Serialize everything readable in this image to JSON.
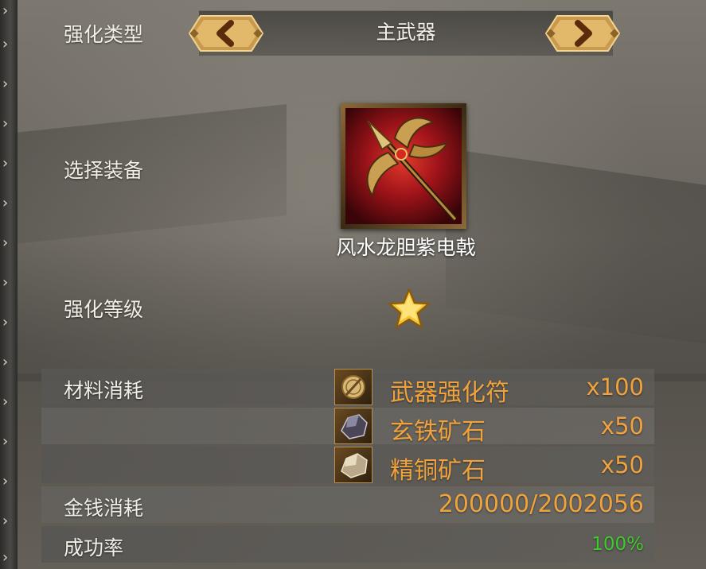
{
  "enhance_type": {
    "label": "强化类型",
    "value": "主武器"
  },
  "select_equipment": {
    "label": "选择装备",
    "item_name": "风水龙胆紫电戟",
    "item_icon": "halberd-icon"
  },
  "enhance_level": {
    "label": "强化等级",
    "stars": 1,
    "star_icon": "gold-star-icon"
  },
  "materials": {
    "label": "材料消耗",
    "items": [
      {
        "name": "武器强化符",
        "qty": "x100",
        "icon": "talisman-icon"
      },
      {
        "name": "玄铁矿石",
        "qty": "x50",
        "icon": "dark-iron-ore-icon"
      },
      {
        "name": "精铜矿石",
        "qty": "x50",
        "icon": "copper-ore-icon"
      }
    ]
  },
  "money_cost": {
    "label": "金钱消耗",
    "value": "200000/2002056"
  },
  "success_rate": {
    "label": "成功率",
    "value": "100%"
  },
  "colors": {
    "accent_orange": "#f0a23c",
    "success_green": "#3ecb2c",
    "label_white": "#f2efe6"
  }
}
